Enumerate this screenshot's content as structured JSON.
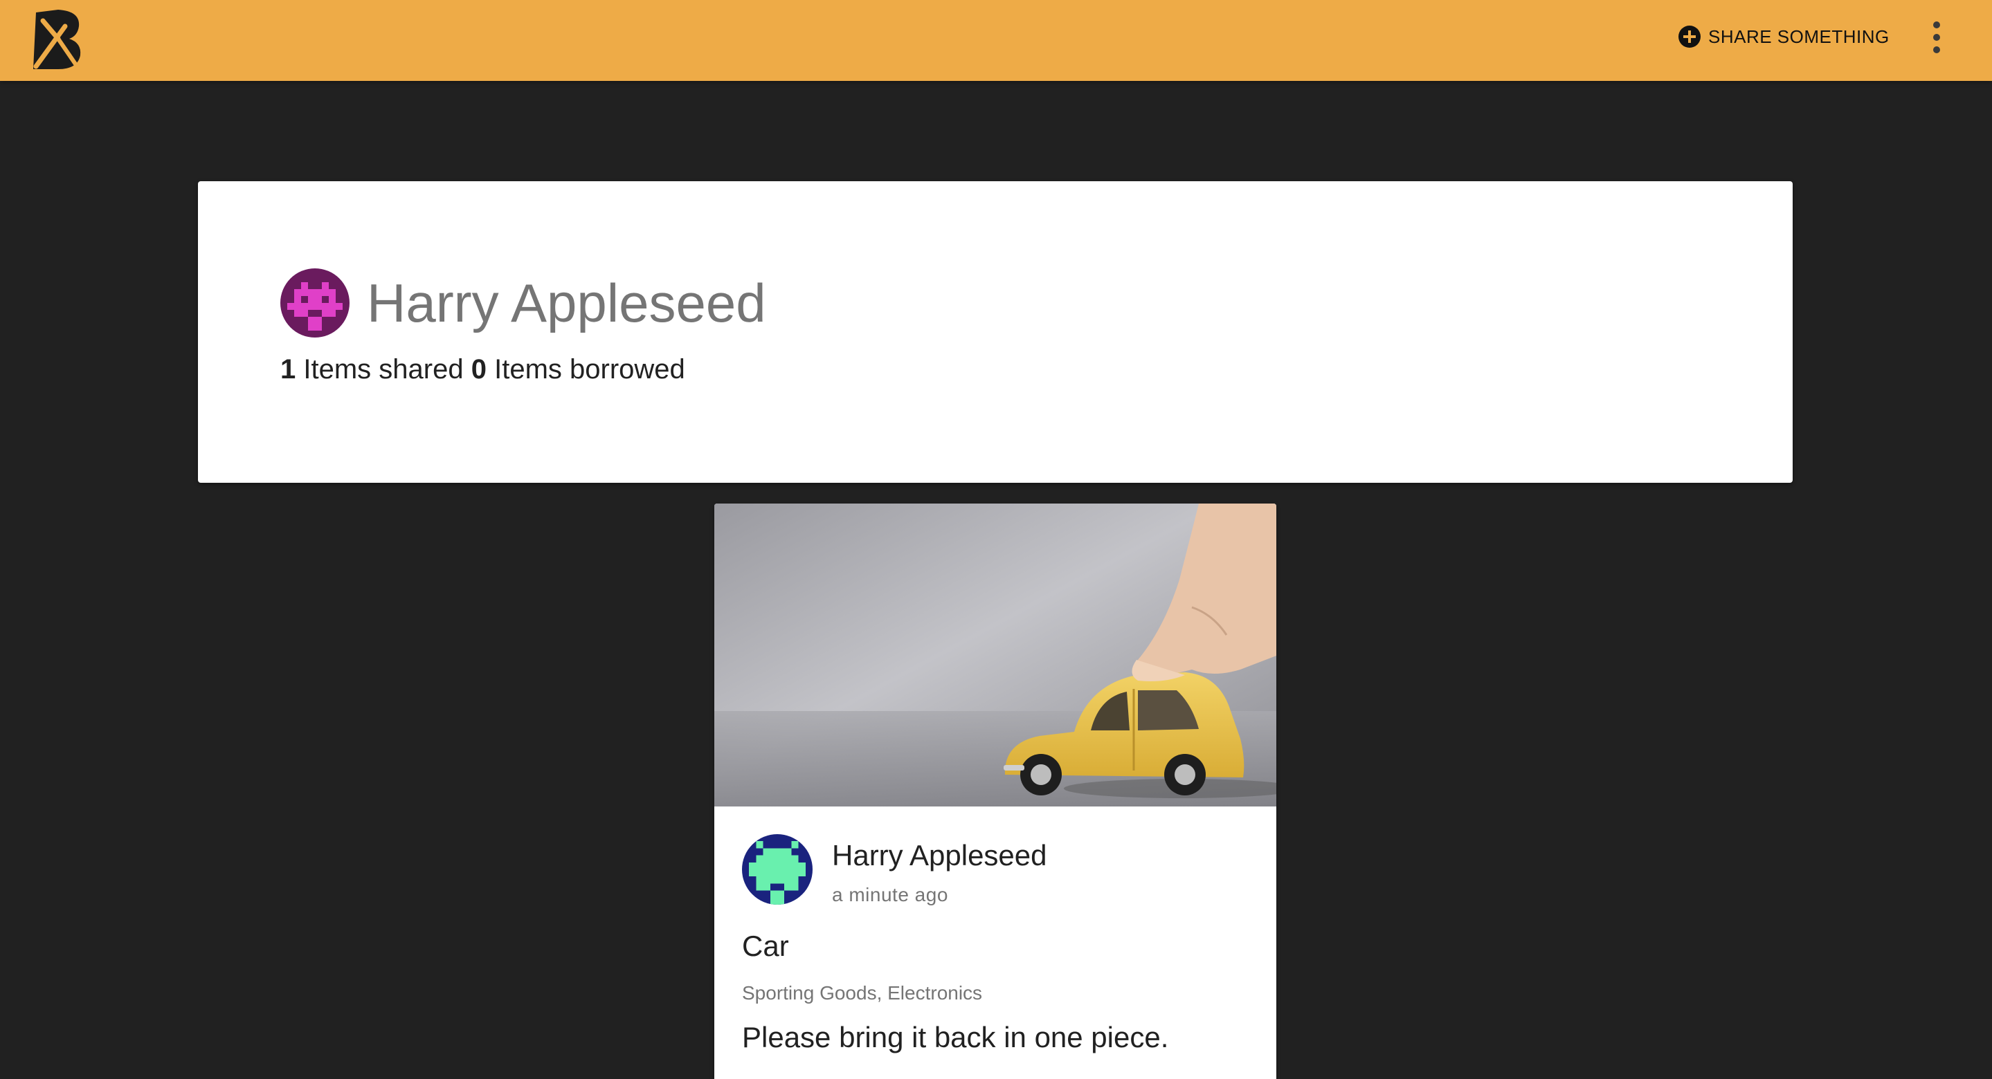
{
  "colors": {
    "appbar": "#EEAB47",
    "page_background": "#212121",
    "card_background": "#FFFFFF",
    "profile_avatar_bg": "#6A1B5E",
    "profile_avatar_fg": "#E040C8",
    "owner_avatar_bg": "#1A237E",
    "owner_avatar_fg": "#69F0AE"
  },
  "header": {
    "logo_icon": "boomtown-logo-icon",
    "share_icon": "add-circle-icon",
    "share_label": "SHARE SOMETHING",
    "menu_icon": "more-vert-icon"
  },
  "profile": {
    "avatar_icon": "pixel-invader-avatar-icon",
    "name": "Harry Appleseed",
    "items_shared_count": "1",
    "items_shared_label": "Items shared",
    "items_borrowed_count": "0",
    "items_borrowed_label": "Items borrowed"
  },
  "items": [
    {
      "image_subject": "yellow toy car",
      "owner_avatar_icon": "pixel-invader-avatar-icon",
      "owner_name": "Harry Appleseed",
      "shared_time": "a minute ago",
      "title": "Car",
      "tags": "Sporting Goods, Electronics",
      "description": "Please bring it back in one piece."
    }
  ]
}
